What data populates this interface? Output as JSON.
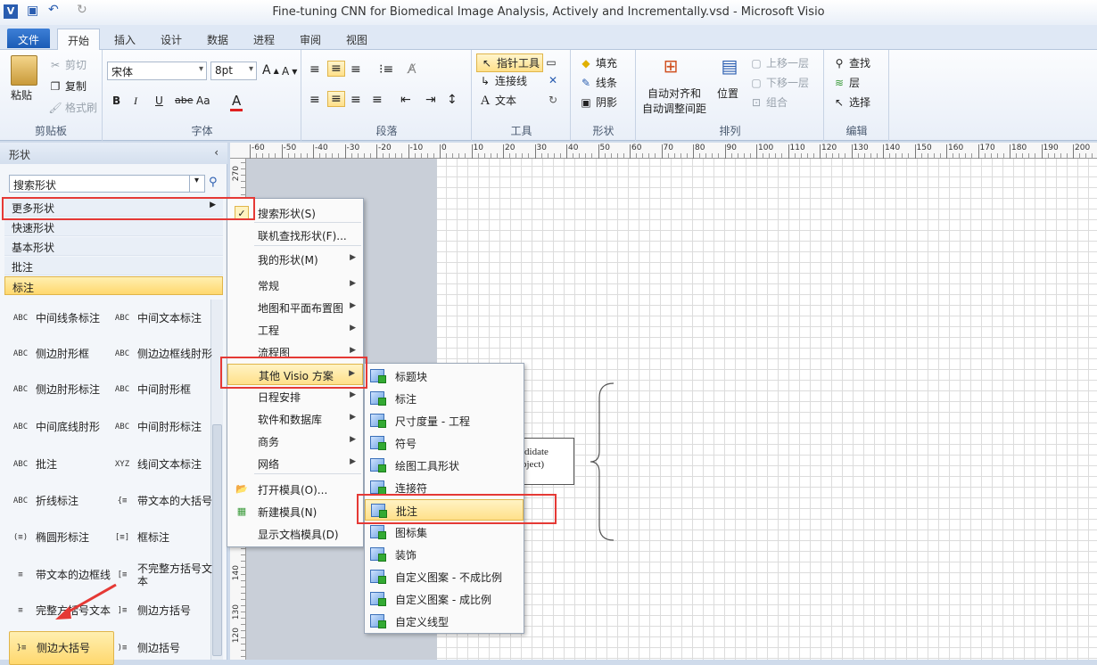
{
  "window": {
    "title": "Fine-tuning CNN for Biomedical Image Analysis, Actively and Incrementally.vsd  -  Microsoft Visio"
  },
  "tabs": [
    "文件",
    "开始",
    "插入",
    "设计",
    "数据",
    "进程",
    "审阅",
    "视图"
  ],
  "ribbon": {
    "clipboard": {
      "paste": "粘贴",
      "cut": "剪切",
      "copy": "复制",
      "format_painter": "格式刷",
      "label": "剪贴板"
    },
    "font": {
      "family": "宋体",
      "size": "8pt",
      "label": "字体",
      "bold": "B",
      "italic": "I",
      "underline": "U",
      "strike": "abe",
      "case": "Aa",
      "color": "A"
    },
    "paragraph": {
      "label": "段落"
    },
    "tools": {
      "pointer": "指针工具",
      "connector": "连接线",
      "text": "文本",
      "label": "工具"
    },
    "shape": {
      "fill": "填充",
      "line": "线条",
      "shadow": "阴影",
      "label": "形状"
    },
    "arrange": {
      "auto_align": "自动对齐和",
      "auto_space": "自动调整间距",
      "position": "位置",
      "bring_forward": "上移一层",
      "send_backward": "下移一层",
      "group": "组合",
      "label": "排列"
    },
    "editing": {
      "find": "查找",
      "layers": "层",
      "select": "选择",
      "label": "编辑"
    }
  },
  "shapes_pane": {
    "title": "形状",
    "search_placeholder": "搜索形状",
    "stencils": [
      "更多形状",
      "快速形状",
      "基本形状",
      "批注",
      "标注"
    ],
    "items": [
      {
        "label": "中间线条标注",
        "icon": "ABC"
      },
      {
        "label": "中间文本标注",
        "icon": "ABC"
      },
      {
        "label": "侧边肘形框",
        "icon": "ABC"
      },
      {
        "label": "侧边边框线肘形",
        "icon": "ABC"
      },
      {
        "label": "侧边肘形标注",
        "icon": "ABC"
      },
      {
        "label": "中间肘形框",
        "icon": "ABC"
      },
      {
        "label": "中间底线肘形",
        "icon": "ABC"
      },
      {
        "label": "中间肘形标注",
        "icon": "ABC"
      },
      {
        "label": "批注",
        "icon": "ABC"
      },
      {
        "label": "线间文本标注",
        "icon": "XYZ"
      },
      {
        "label": "折线标注",
        "icon": "ABC"
      },
      {
        "label": "带文本的大括号",
        "icon": "{≡"
      },
      {
        "label": "椭圆形标注",
        "icon": "(≡)"
      },
      {
        "label": "框标注",
        "icon": "[≡]"
      },
      {
        "label": "带文本的边框线",
        "icon": "≡"
      },
      {
        "label": "不完整方括号文本",
        "icon": "[≡"
      },
      {
        "label": "完整方括号文本",
        "icon": "≡"
      },
      {
        "label": "侧边方括号",
        "icon": "]≡"
      },
      {
        "label": "侧边大括号",
        "icon": "}≡"
      },
      {
        "label": "侧边括号",
        "icon": ")≡"
      }
    ]
  },
  "menu1": {
    "items": [
      {
        "label": "搜索形状(S)",
        "checked": true
      },
      {
        "label": "联机查找形状(F)..."
      },
      {
        "label": "我的形状(M)",
        "sub": true
      },
      {
        "label": "常规",
        "sub": true
      },
      {
        "label": "地图和平面布置图",
        "sub": true
      },
      {
        "label": "工程",
        "sub": true
      },
      {
        "label": "流程图",
        "sub": true
      },
      {
        "label": "其他 Visio 方案",
        "sub": true
      },
      {
        "label": "日程安排",
        "sub": true
      },
      {
        "label": "软件和数据库",
        "sub": true
      },
      {
        "label": "商务",
        "sub": true
      },
      {
        "label": "网络",
        "sub": true
      },
      {
        "label": "打开模具(O)..."
      },
      {
        "label": "新建模具(N)"
      },
      {
        "label": "显示文档模具(D)"
      }
    ]
  },
  "menu2": {
    "items": [
      "标题块",
      "标注",
      "尺寸度量 - 工程",
      "符号",
      "绘图工具形状",
      "连接符",
      "批注",
      "图标集",
      "装饰",
      "自定义图案 - 不成比例",
      "自定义图案 - 成比例",
      "自定义线型"
    ]
  },
  "canvas": {
    "box_text_1": "ididate",
    "box_text_2": "bject)"
  },
  "ruler_top": [
    "-60",
    "-50",
    "-40",
    "-30",
    "-20",
    "-10",
    "0",
    "10",
    "20",
    "30",
    "40",
    "50",
    "60",
    "70",
    "80",
    "90",
    "100",
    "110",
    "120",
    "130",
    "140",
    "150",
    "160",
    "170",
    "180",
    "190",
    "200"
  ],
  "ruler_left": [
    "270",
    "140",
    "130",
    "120"
  ]
}
